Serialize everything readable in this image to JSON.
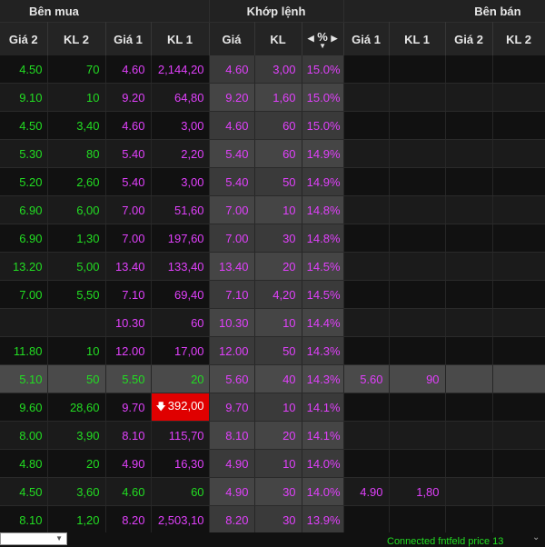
{
  "groups": {
    "buy": "Bên mua",
    "match": "Khớp lệnh",
    "sell": "Bên bán"
  },
  "headers": {
    "buy_price2": "Giá 2",
    "buy_vol2": "KL 2",
    "buy_price1": "Giá 1",
    "buy_vol1": "KL 1",
    "match_price": "Giá",
    "match_vol": "KL",
    "match_pct": "%",
    "sell_price1": "Giá 1",
    "sell_vol1": "KL 1",
    "sell_price2": "Giá 2",
    "sell_vol2": "KL 2"
  },
  "colors": {
    "up": "#22dd22",
    "ceiling": "#e040fb",
    "alert": "#e00000"
  },
  "rows": [
    {
      "b2": "4.50",
      "bk2": "70",
      "b1": "4.60",
      "bk1": "2,144,20",
      "mp": "4.60",
      "mk": "3,00",
      "pct": "15.0%",
      "s1": "",
      "sk1": "",
      "s2": "",
      "sk2": "",
      "b2c": "green",
      "bk2c": "green",
      "b1c": "magenta",
      "bk1c": "magenta"
    },
    {
      "b2": "9.10",
      "bk2": "10",
      "b1": "9.20",
      "bk1": "64,80",
      "mp": "9.20",
      "mk": "1,60",
      "pct": "15.0%",
      "s1": "",
      "sk1": "",
      "s2": "",
      "sk2": "",
      "b2c": "green",
      "bk2c": "green",
      "b1c": "magenta",
      "bk1c": "magenta"
    },
    {
      "b2": "4.50",
      "bk2": "3,40",
      "b1": "4.60",
      "bk1": "3,00",
      "mp": "4.60",
      "mk": "60",
      "pct": "15.0%",
      "s1": "",
      "sk1": "",
      "s2": "",
      "sk2": "",
      "b2c": "green",
      "bk2c": "green",
      "b1c": "magenta",
      "bk1c": "magenta"
    },
    {
      "b2": "5.30",
      "bk2": "80",
      "b1": "5.40",
      "bk1": "2,20",
      "mp": "5.40",
      "mk": "60",
      "pct": "14.9%",
      "s1": "",
      "sk1": "",
      "s2": "",
      "sk2": "",
      "b2c": "green",
      "bk2c": "green",
      "b1c": "magenta",
      "bk1c": "magenta"
    },
    {
      "b2": "5.20",
      "bk2": "2,60",
      "b1": "5.40",
      "bk1": "3,00",
      "mp": "5.40",
      "mk": "50",
      "pct": "14.9%",
      "s1": "",
      "sk1": "",
      "s2": "",
      "sk2": "",
      "b2c": "green",
      "bk2c": "green",
      "b1c": "magenta",
      "bk1c": "magenta"
    },
    {
      "b2": "6.90",
      "bk2": "6,00",
      "b1": "7.00",
      "bk1": "51,60",
      "mp": "7.00",
      "mk": "10",
      "pct": "14.8%",
      "s1": "",
      "sk1": "",
      "s2": "",
      "sk2": "",
      "b2c": "green",
      "bk2c": "green",
      "b1c": "magenta",
      "bk1c": "magenta"
    },
    {
      "b2": "6.90",
      "bk2": "1,30",
      "b1": "7.00",
      "bk1": "197,60",
      "mp": "7.00",
      "mk": "30",
      "pct": "14.8%",
      "s1": "",
      "sk1": "",
      "s2": "",
      "sk2": "",
      "b2c": "green",
      "bk2c": "green",
      "b1c": "magenta",
      "bk1c": "magenta"
    },
    {
      "b2": "13.20",
      "bk2": "5,00",
      "b1": "13.40",
      "bk1": "133,40",
      "mp": "13.40",
      "mk": "20",
      "pct": "14.5%",
      "s1": "",
      "sk1": "",
      "s2": "",
      "sk2": "",
      "b2c": "green",
      "bk2c": "green",
      "b1c": "magenta",
      "bk1c": "magenta"
    },
    {
      "b2": "7.00",
      "bk2": "5,50",
      "b1": "7.10",
      "bk1": "69,40",
      "mp": "7.10",
      "mk": "4,20",
      "pct": "14.5%",
      "s1": "",
      "sk1": "",
      "s2": "",
      "sk2": "",
      "b2c": "green",
      "bk2c": "green",
      "b1c": "magenta",
      "bk1c": "magenta"
    },
    {
      "b2": "",
      "bk2": "",
      "b1": "10.30",
      "bk1": "60",
      "mp": "10.30",
      "mk": "10",
      "pct": "14.4%",
      "s1": "",
      "sk1": "",
      "s2": "",
      "sk2": "",
      "b2c": "green",
      "bk2c": "green",
      "b1c": "magenta",
      "bk1c": "magenta"
    },
    {
      "b2": "11.80",
      "bk2": "10",
      "b1": "12.00",
      "bk1": "17,00",
      "mp": "12.00",
      "mk": "50",
      "pct": "14.3%",
      "s1": "",
      "sk1": "",
      "s2": "",
      "sk2": "",
      "b2c": "green",
      "bk2c": "green",
      "b1c": "magenta",
      "bk1c": "magenta"
    },
    {
      "b2": "5.10",
      "bk2": "50",
      "b1": "5.50",
      "bk1": "20",
      "mp": "5.60",
      "mk": "40",
      "pct": "14.3%",
      "s1": "5.60",
      "sk1": "90",
      "s2": "",
      "sk2": "",
      "b2c": "green",
      "bk2c": "green",
      "b1c": "green",
      "bk1c": "green",
      "highlight": true
    },
    {
      "b2": "9.60",
      "bk2": "28,60",
      "b1": "9.70",
      "bk1": "392,00",
      "mp": "9.70",
      "mk": "10",
      "pct": "14.1%",
      "s1": "",
      "sk1": "",
      "s2": "",
      "sk2": "",
      "b2c": "green",
      "bk2c": "green",
      "b1c": "magenta",
      "bk1c": "magenta",
      "alert_bk1": true
    },
    {
      "b2": "8.00",
      "bk2": "3,90",
      "b1": "8.10",
      "bk1": "115,70",
      "mp": "8.10",
      "mk": "20",
      "pct": "14.1%",
      "s1": "",
      "sk1": "",
      "s2": "",
      "sk2": "",
      "b2c": "green",
      "bk2c": "green",
      "b1c": "magenta",
      "bk1c": "magenta"
    },
    {
      "b2": "4.80",
      "bk2": "20",
      "b1": "4.90",
      "bk1": "16,30",
      "mp": "4.90",
      "mk": "10",
      "pct": "14.0%",
      "s1": "",
      "sk1": "",
      "s2": "",
      "sk2": "",
      "b2c": "green",
      "bk2c": "green",
      "b1c": "magenta",
      "bk1c": "magenta"
    },
    {
      "b2": "4.50",
      "bk2": "3,60",
      "b1": "4.60",
      "bk1": "60",
      "mp": "4.90",
      "mk": "30",
      "pct": "14.0%",
      "s1": "4.90",
      "sk1": "1,80",
      "s2": "",
      "sk2": "",
      "b2c": "green",
      "bk2c": "green",
      "b1c": "green",
      "bk1c": "green"
    },
    {
      "b2": "8.10",
      "bk2": "1,20",
      "b1": "8.20",
      "bk1": "2,503,10",
      "mp": "8.20",
      "mk": "30",
      "pct": "13.9%",
      "s1": "",
      "sk1": "",
      "s2": "",
      "sk2": "",
      "b2c": "green",
      "bk2c": "green",
      "b1c": "magenta",
      "bk1c": "magenta"
    }
  ],
  "footer": {
    "status": "Connected fntfeld price 13"
  }
}
